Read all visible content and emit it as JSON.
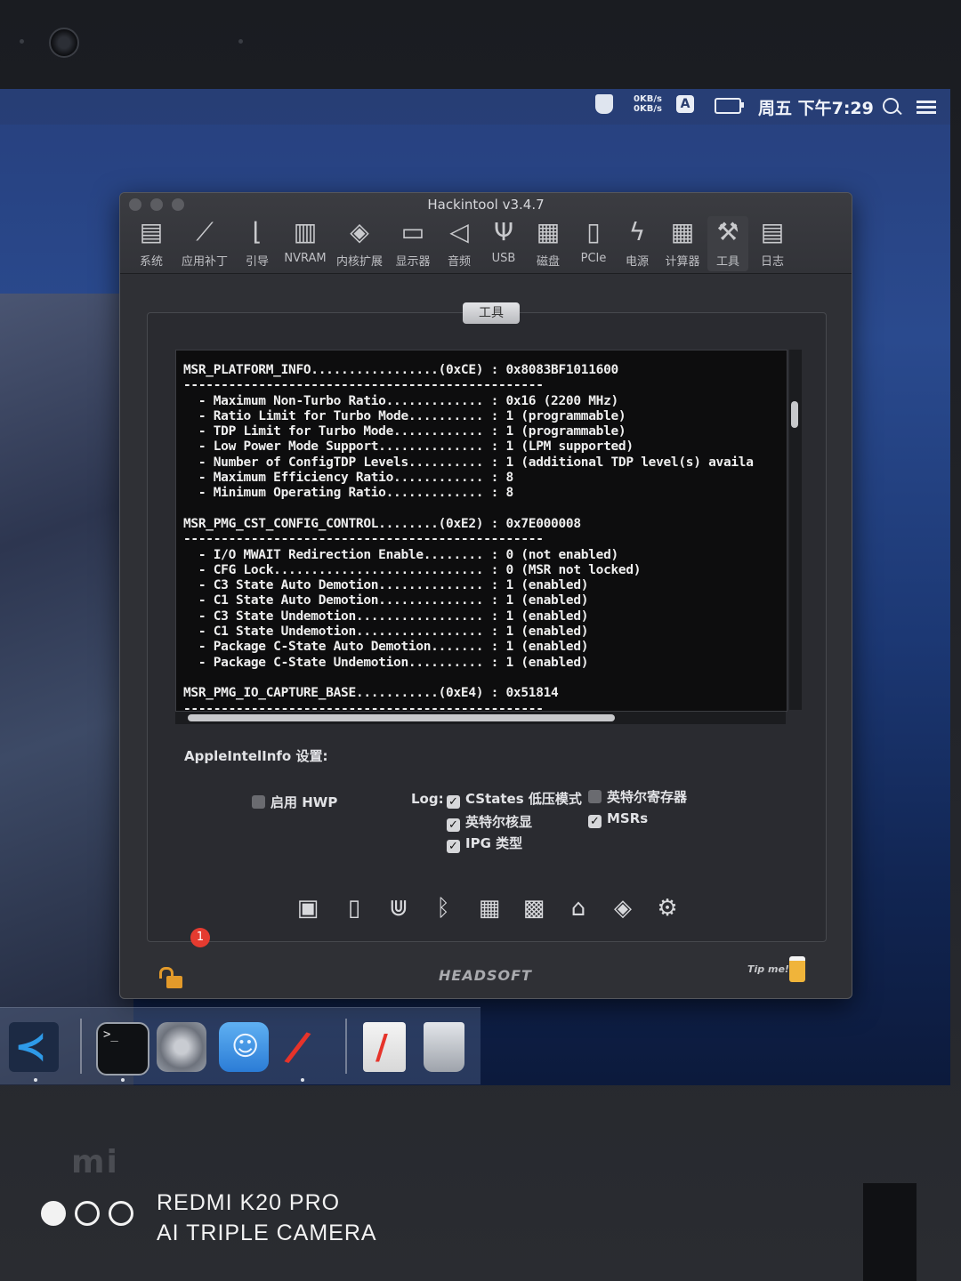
{
  "menubar": {
    "net_up": "0KB/s",
    "net_down": "0KB/s",
    "input_method": "A",
    "clock": "周五 下午7:29"
  },
  "window": {
    "title": "Hackintool v3.4.7",
    "toolbar": [
      {
        "label": "系统",
        "icon": "computer-icon"
      },
      {
        "label": "应用补丁",
        "icon": "bandage-icon"
      },
      {
        "label": "引导",
        "icon": "boot-icon"
      },
      {
        "label": "NVRAM",
        "icon": "memory-chip-icon"
      },
      {
        "label": "内核扩展",
        "icon": "lego-brick-icon"
      },
      {
        "label": "显示器",
        "icon": "monitor-icon"
      },
      {
        "label": "音频",
        "icon": "speaker-icon"
      },
      {
        "label": "USB",
        "icon": "usb-icon"
      },
      {
        "label": "磁盘",
        "icon": "disk-icon"
      },
      {
        "label": "PCIe",
        "icon": "pcie-card-icon"
      },
      {
        "label": "电源",
        "icon": "power-icon"
      },
      {
        "label": "计算器",
        "icon": "calculator-icon"
      },
      {
        "label": "工具",
        "icon": "wrench-icon"
      },
      {
        "label": "日志",
        "icon": "log-icon"
      }
    ],
    "active_tab": "工具"
  },
  "console_text": "MSR_PLATFORM_INFO.................(0xCE) : 0x8083BF1011600\n------------------------------------------------\n  - Maximum Non-Turbo Ratio............. : 0x16 (2200 MHz)\n  - Ratio Limit for Turbo Mode.......... : 1 (programmable)\n  - TDP Limit for Turbo Mode............ : 1 (programmable)\n  - Low Power Mode Support.............. : 1 (LPM supported)\n  - Number of ConfigTDP Levels.......... : 1 (additional TDP level(s) availa\n  - Maximum Efficiency Ratio............ : 8\n  - Minimum Operating Ratio............. : 8\n\nMSR_PMG_CST_CONFIG_CONTROL........(0xE2) : 0x7E000008\n------------------------------------------------\n  - I/O MWAIT Redirection Enable........ : 0 (not enabled)\n  - CFG Lock............................ : 0 (MSR not locked)\n  - C3 State Auto Demotion.............. : 1 (enabled)\n  - C1 State Auto Demotion.............. : 1 (enabled)\n  - C3 State Undemotion................. : 1 (enabled)\n  - C1 State Undemotion................. : 1 (enabled)\n  - Package C-State Auto Demotion....... : 1 (enabled)\n  - Package C-State Undemotion.......... : 1 (enabled)\n\nMSR_PMG_IO_CAPTURE_BASE...........(0xE4) : 0x51814\n------------------------------------------------",
  "settings": {
    "title": "AppleIntelInfo 设置:",
    "hwp": {
      "label": "启用 HWP",
      "checked": false
    },
    "log_label": "Log:",
    "options": [
      {
        "label": "CStates 低压模式",
        "checked": true
      },
      {
        "label": "英特尔寄存器",
        "checked": false
      },
      {
        "label": "英特尔核显",
        "checked": true
      },
      {
        "label": "MSRs",
        "checked": true
      },
      {
        "label": "IPG 类型",
        "checked": true
      }
    ],
    "check_mark": "✓"
  },
  "tool_icons": [
    "cpu-icon",
    "sd-card-icon",
    "usb-connector-icon",
    "bluetooth-icon",
    "grid-icon",
    "keyboard-grid-icon",
    "home-icon",
    "kext-icon",
    "kext-gear-icon"
  ],
  "footer": {
    "brand": "HEADSOFT",
    "tip": "Tip me!"
  },
  "dock": {
    "badge": "1",
    "apps": [
      "vscode-icon",
      "terminal-icon",
      "system-preferences-icon",
      "finder-icon",
      "hackintool-icon",
      "hackintool-doc-icon",
      "trash-icon"
    ]
  },
  "device": {
    "logo": "mi",
    "watermark_line1": "REDMI K20 PRO",
    "watermark_line2": "AI TRIPLE CAMERA"
  }
}
